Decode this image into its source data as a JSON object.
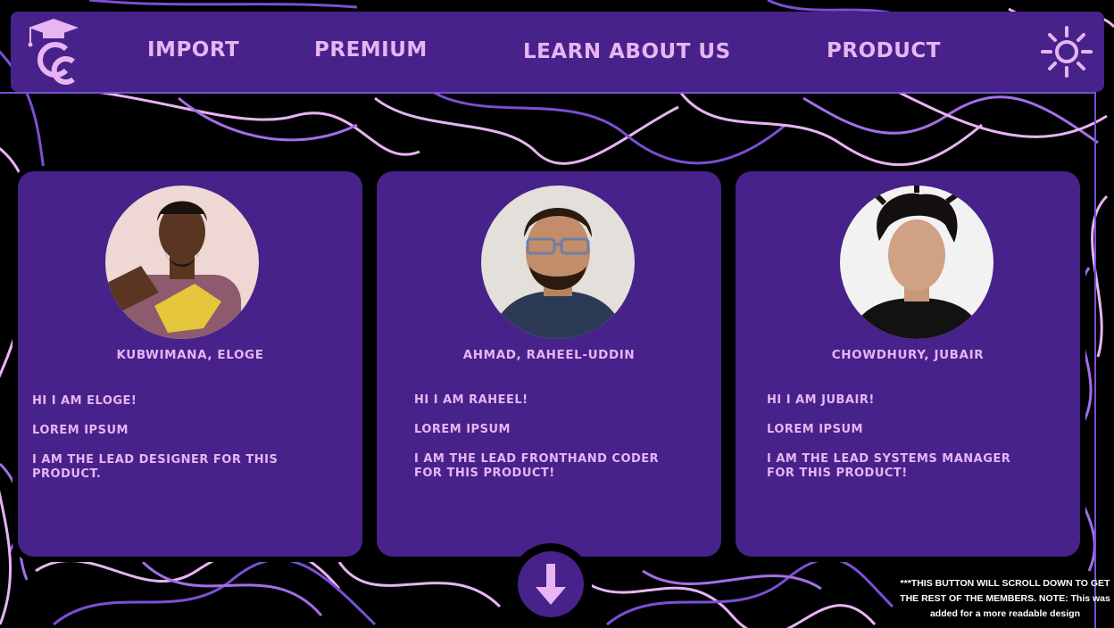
{
  "colors": {
    "background": "#000000",
    "panel": "#46228a",
    "accent_text": "#e8b4f2",
    "swirl_pink": "#e8b4f2",
    "swirl_purple": "#7b4fd6",
    "note_text": "#ffffff"
  },
  "header": {
    "logo_icon": "graduation-cap-cc-logo",
    "nav": [
      {
        "label": "IMPORT"
      },
      {
        "label": "PREMIUM"
      },
      {
        "label": "LEARN ABOUT US"
      },
      {
        "label": "PRODUCT"
      }
    ],
    "theme_icon": "sun-icon"
  },
  "members": [
    {
      "name": "KUBWIMANA, ELOGE",
      "bio": [
        "HI I AM ELOGE!",
        "LOREM IPSUM",
        "I AM THE LEAD DESIGNER FOR THIS PRODUCT."
      ]
    },
    {
      "name": "AHMAD, RAHEEL-UDDIN",
      "bio": [
        "HI I AM RAHEEL!",
        "LOREM IPSUM",
        "I AM THE LEAD FRONTHAND CODER FOR THIS PRODUCT!"
      ]
    },
    {
      "name": "CHOWDHURY, JUBAIR",
      "bio": [
        "HI I AM JUBAIR!",
        "LOREM IPSUM",
        "I AM THE LEAD SYSTEMS MANAGER FOR THIS PRODUCT!"
      ]
    }
  ],
  "scroll_button": {
    "icon": "arrow-down-icon"
  },
  "note": "***THIS BUTTON WILL SCROLL DOWN TO GET THE REST OF THE MEMBERS. NOTE: This was added for a more readable design"
}
